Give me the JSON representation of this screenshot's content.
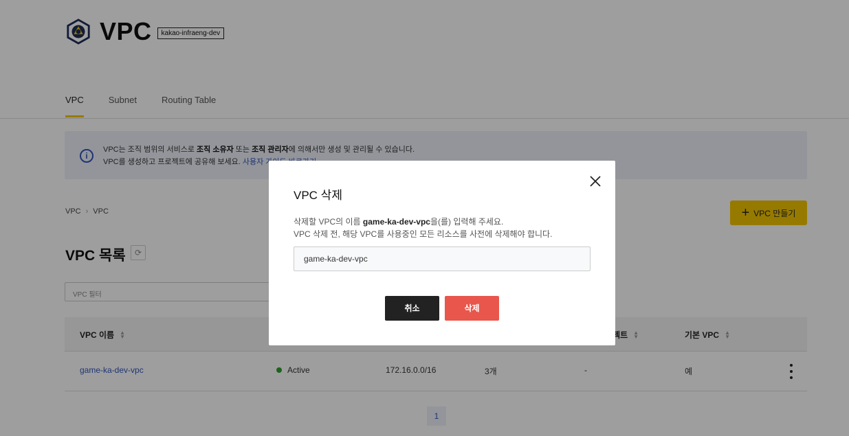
{
  "header": {
    "title": "VPC",
    "org_badge": "kakao-infraeng-dev"
  },
  "tabs": [
    {
      "label": "VPC",
      "active": true
    },
    {
      "label": "Subnet",
      "active": false
    },
    {
      "label": "Routing Table",
      "active": false
    }
  ],
  "info": {
    "line1_a": "VPC는 조직 범위의 서비스로 ",
    "line1_b": "조직 소유자",
    "line1_c": " 또는 ",
    "line1_d": "조직 관리자",
    "line1_e": "에 의해서만 생성 및 관리될 수 있습니다.",
    "line2_a": "VPC를 생성하고 프로젝트에 공유해 보세요. ",
    "line2_link": "사용자 가이드 바로가기"
  },
  "breadcrumb": [
    "VPC",
    "VPC"
  ],
  "create_button": "VPC 만들기",
  "list_title": "VPC 목록",
  "filter_placeholder": "VPC 필터",
  "table": {
    "headers": [
      "VPC 이름",
      "프로젝트",
      "기본 VPC"
    ],
    "rows": [
      {
        "name": "game-ka-dev-vpc",
        "status": "Active",
        "cidr": "172.16.0.0/16",
        "count": "3개",
        "project": "-",
        "default": "예"
      }
    ]
  },
  "pagination": {
    "current": "1"
  },
  "modal": {
    "title": "VPC 삭제",
    "desc1_a": "삭제할 VPC의 이름 ",
    "desc1_b": "game-ka-dev-vpc",
    "desc1_c": "을(를) 입력해 주세요.",
    "desc2": "VPC 삭제 전, 해당 VPC를 사용중인 모든 리소스를 사전에 삭제해야 합니다.",
    "input_value": "game-ka-dev-vpc",
    "cancel_label": "취소",
    "delete_label": "삭제"
  },
  "colors": {
    "accent": "#f2c500",
    "link": "#3355bb",
    "danger": "#e8564c",
    "active_status": "#2fa02f"
  }
}
